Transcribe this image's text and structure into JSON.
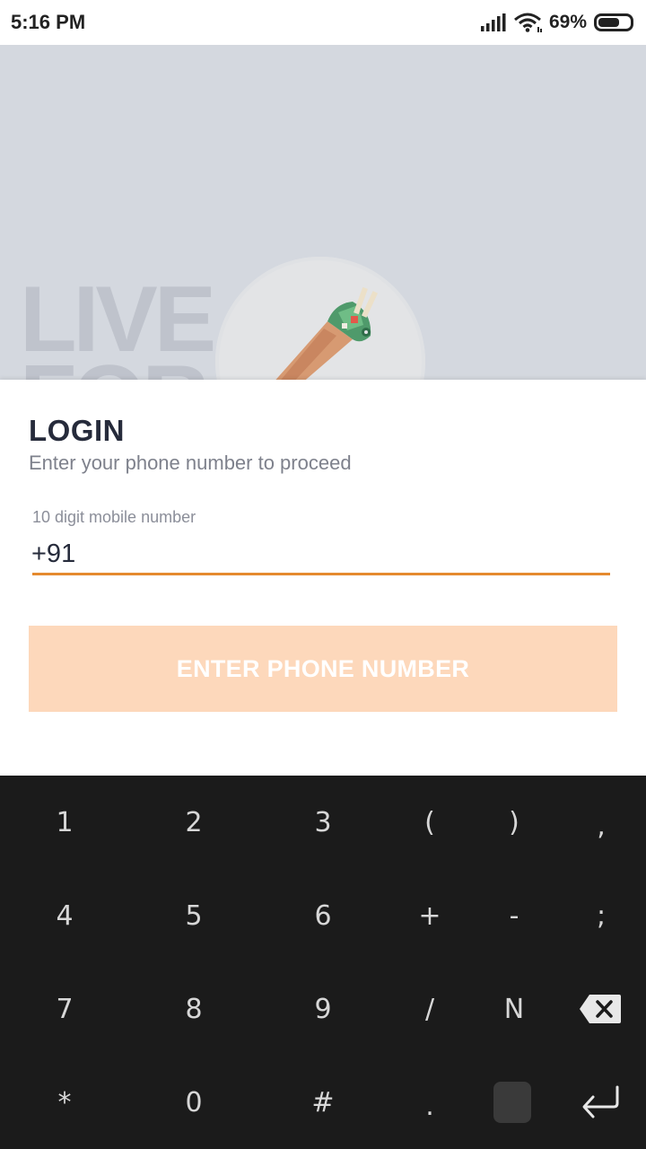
{
  "status_bar": {
    "time": "5:16 PM",
    "battery_percent": "69%",
    "battery_level": 0.69
  },
  "hero": {
    "lettering": "LIVE\nFOR"
  },
  "login": {
    "title": "LOGIN",
    "subtitle": "Enter your phone number to proceed",
    "phone_label": "10 digit mobile number",
    "phone_value": "+91",
    "submit_label": "ENTER PHONE NUMBER"
  },
  "colors": {
    "accent": "#e58a2e",
    "button_disabled": "#fdd8bb",
    "title_text": "#262b3b",
    "hero_bg": "#d4d8df",
    "keyboard_bg": "#1b1b1b"
  },
  "keyboard": {
    "row1": [
      "1",
      "2",
      "3",
      "(",
      ")",
      ","
    ],
    "row2": [
      "4",
      "5",
      "6",
      "+",
      "-",
      ";"
    ],
    "row3": [
      "7",
      "8",
      "9",
      "/",
      "N"
    ],
    "row4": [
      "*",
      "0",
      "#",
      "."
    ],
    "special_icons": [
      "backspace-icon",
      "space-key",
      "enter-icon"
    ]
  }
}
